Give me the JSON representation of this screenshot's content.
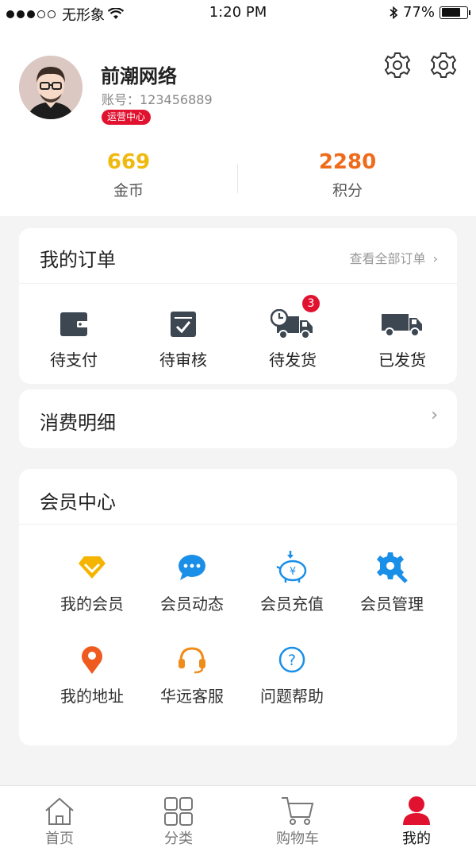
{
  "status_bar": {
    "carrier": "无形象",
    "time": "1:20 PM",
    "battery": "77%",
    "battery_level": 0.77
  },
  "profile": {
    "name": "前潮网络",
    "account": "账号：123456889",
    "badge": "运营中心"
  },
  "stats": [
    {
      "value": "669",
      "label": "金币",
      "color": "#f0b90e"
    },
    {
      "value": "2280",
      "label": "积分",
      "color": "#ef6b1b"
    }
  ],
  "orders": {
    "title": "我的订单",
    "view_all": "查看全部订单",
    "items": [
      {
        "label": "待支付",
        "icon": "wallet-icon"
      },
      {
        "label": "待审核",
        "icon": "check-box-icon"
      },
      {
        "label": "待发货",
        "icon": "truck-clock-icon",
        "badge": "3"
      },
      {
        "label": "已发货",
        "icon": "truck-icon"
      }
    ]
  },
  "expense": {
    "title": "消费明细"
  },
  "member": {
    "title": "会员中心",
    "items": [
      {
        "label": "我的会员",
        "icon": "diamond-icon",
        "color": "#f5b400"
      },
      {
        "label": "会员动态",
        "icon": "chat-bubble-icon",
        "color": "#1a8fe8"
      },
      {
        "label": "会员充值",
        "icon": "piggy-bank-icon",
        "color": "#1a8fe8"
      },
      {
        "label": "会员管理",
        "icon": "gear-wrench-icon",
        "color": "#1a8fe8"
      },
      {
        "label": "我的地址",
        "icon": "location-pin-icon",
        "color": "#ef5a1f"
      },
      {
        "label": "华远客服",
        "icon": "headset-icon",
        "color": "#f08c1a"
      },
      {
        "label": "问题帮助",
        "icon": "question-icon",
        "color": "#1a8fe8"
      }
    ]
  },
  "tabs": [
    {
      "label": "首页",
      "icon": "home-icon",
      "active": false
    },
    {
      "label": "分类",
      "icon": "grid-icon",
      "active": false
    },
    {
      "label": "购物车",
      "icon": "cart-icon",
      "active": false
    },
    {
      "label": "我的",
      "icon": "user-icon",
      "active": true
    }
  ],
  "colors": {
    "accent": "#e0122f",
    "text": "#222222",
    "muted": "#999999"
  }
}
